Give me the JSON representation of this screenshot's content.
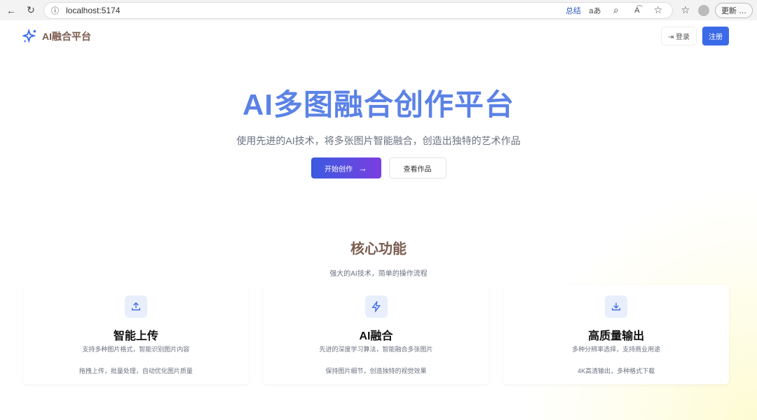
{
  "browser": {
    "url": "localhost:5174",
    "summary": "总结",
    "update": "更新"
  },
  "nav": {
    "brand": "AI融合平台",
    "login": "登录",
    "register": "注册"
  },
  "hero": {
    "title": "AI多图融合创作平台",
    "subtitle": "使用先进的AI技术，将多张图片智能融合，创造出独特的艺术作品",
    "start": "开始创作",
    "view": "查看作品"
  },
  "features": {
    "title": "核心功能",
    "subtitle": "强大的AI技术，简单的操作流程",
    "cards": [
      {
        "icon": "upload-icon",
        "title": "智能上传",
        "desc": "支持多种图片格式，智能识别图片内容",
        "extra": "拖拽上传，批量处理，自动优化图片质量"
      },
      {
        "icon": "lightning-icon",
        "title": "AI融合",
        "desc": "先进的深度学习算法，智能融合多张图片",
        "extra": "保持图片细节，创造独特的视觉效果"
      },
      {
        "icon": "download-icon",
        "title": "高质量输出",
        "desc": "多种分辨率选择，支持商业用途",
        "extra": "4K高清输出，多种格式下载"
      }
    ]
  }
}
